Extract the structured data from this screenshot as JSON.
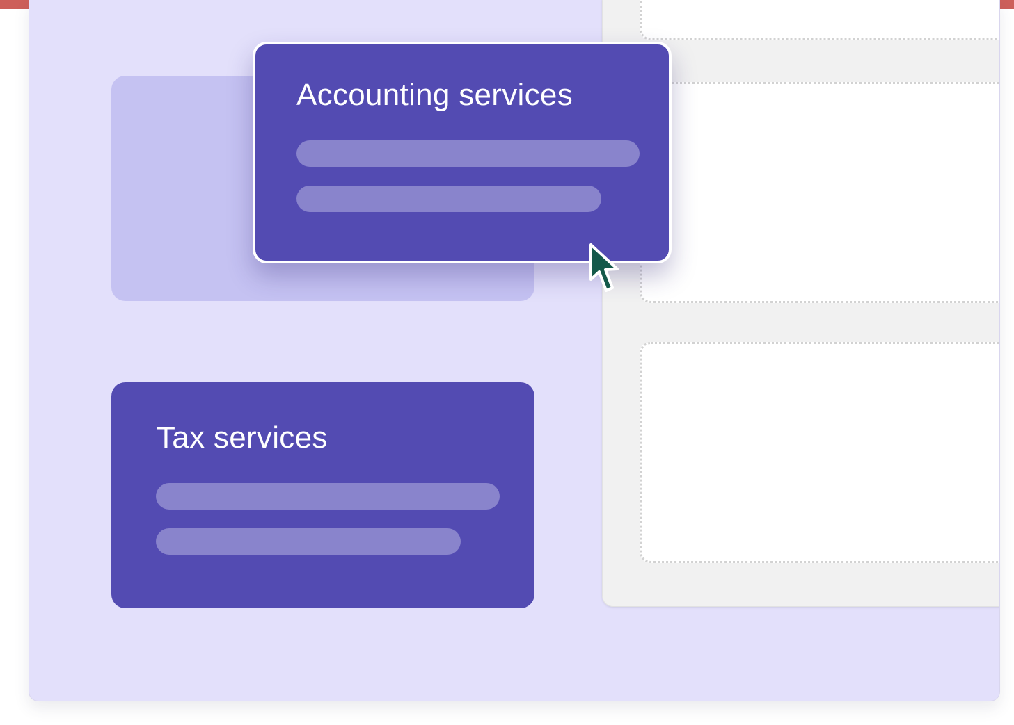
{
  "cards": {
    "dragging": {
      "title": "Accounting services"
    },
    "tax": {
      "title": "Tax services"
    }
  },
  "icons": {
    "cursor": "mouse-pointer-icon"
  },
  "colors": {
    "top_bar": "#cd5f5a",
    "panel_background": "#e3e0fb",
    "card": "#534bb2",
    "card_line": "#8984cc",
    "ghost_placeholder": "#c5c2f2",
    "drop_zone": "#f1f1f1",
    "cursor": "#14594a"
  }
}
